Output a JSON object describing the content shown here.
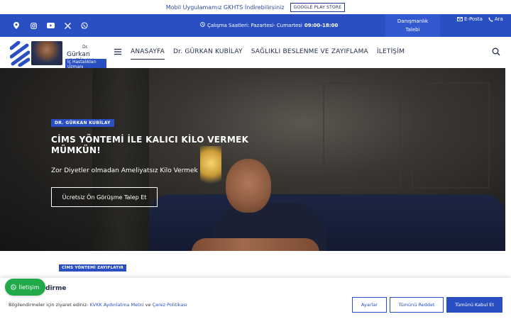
{
  "announcement": {
    "text": "Mobil Uygulamamız GKHTS İndirebilirsiniz",
    "button_label": "GOOGLE PLAY STORE"
  },
  "infobar": {
    "social_icons": [
      "map-pin-icon",
      "instagram-icon",
      "youtube-icon",
      "x-twitter-icon",
      "whatsapp-icon"
    ],
    "hours_label": "Çalışma Saatleri: Pazartesi- Cumartesi",
    "hours_value": "09:00-18:00",
    "consult_label": "Danışmanlık Talebi",
    "email_label": "E-Posta",
    "call_label": "Ara"
  },
  "logo": {
    "dr": "Dr.",
    "name": "Gürkan KUBİLAY",
    "subtitle": "İç Hastalıkları Uzmanı"
  },
  "nav": {
    "items": [
      {
        "label": "ANASAYFA",
        "active": true
      },
      {
        "label": "Dr. GÜRKAN KUBİLAY",
        "active": false
      },
      {
        "label": "SAĞLIKLI BESLENME VE ZAYIFLAMA",
        "active": false
      },
      {
        "label": "İLETİŞİM",
        "active": false
      }
    ]
  },
  "hero": {
    "tag": "DR. GÜRKAN KUBİLAY",
    "title": "CİMS YÖNTEMİ İLE KALICI KİLO VERMEK MÜMKÜN!",
    "subtitle": "Zor Diyetler olmadan Ameliyatsız Kilo Vermek",
    "button_label": "Ücretsiz Ön Görüşme Talep Et"
  },
  "section": {
    "tag": "CİMS YÖNTEMİ ZAYIFLATIR"
  },
  "whatsapp": {
    "label": "İletişim"
  },
  "cookie": {
    "title": "dirme",
    "text_prefix": "Bilgilendirmeler için ziyaret ediniz-",
    "link1": "KVKK Aydınlatma Metni",
    "and": "ve",
    "link2": "Çerez Politikası",
    "settings_label": "Ayarlar",
    "reject_label": "Tümünü Reddet",
    "accept_label": "Tümünü Kabul Et"
  },
  "colors": {
    "primary": "#2a4fc2",
    "whatsapp": "#22a94a"
  }
}
